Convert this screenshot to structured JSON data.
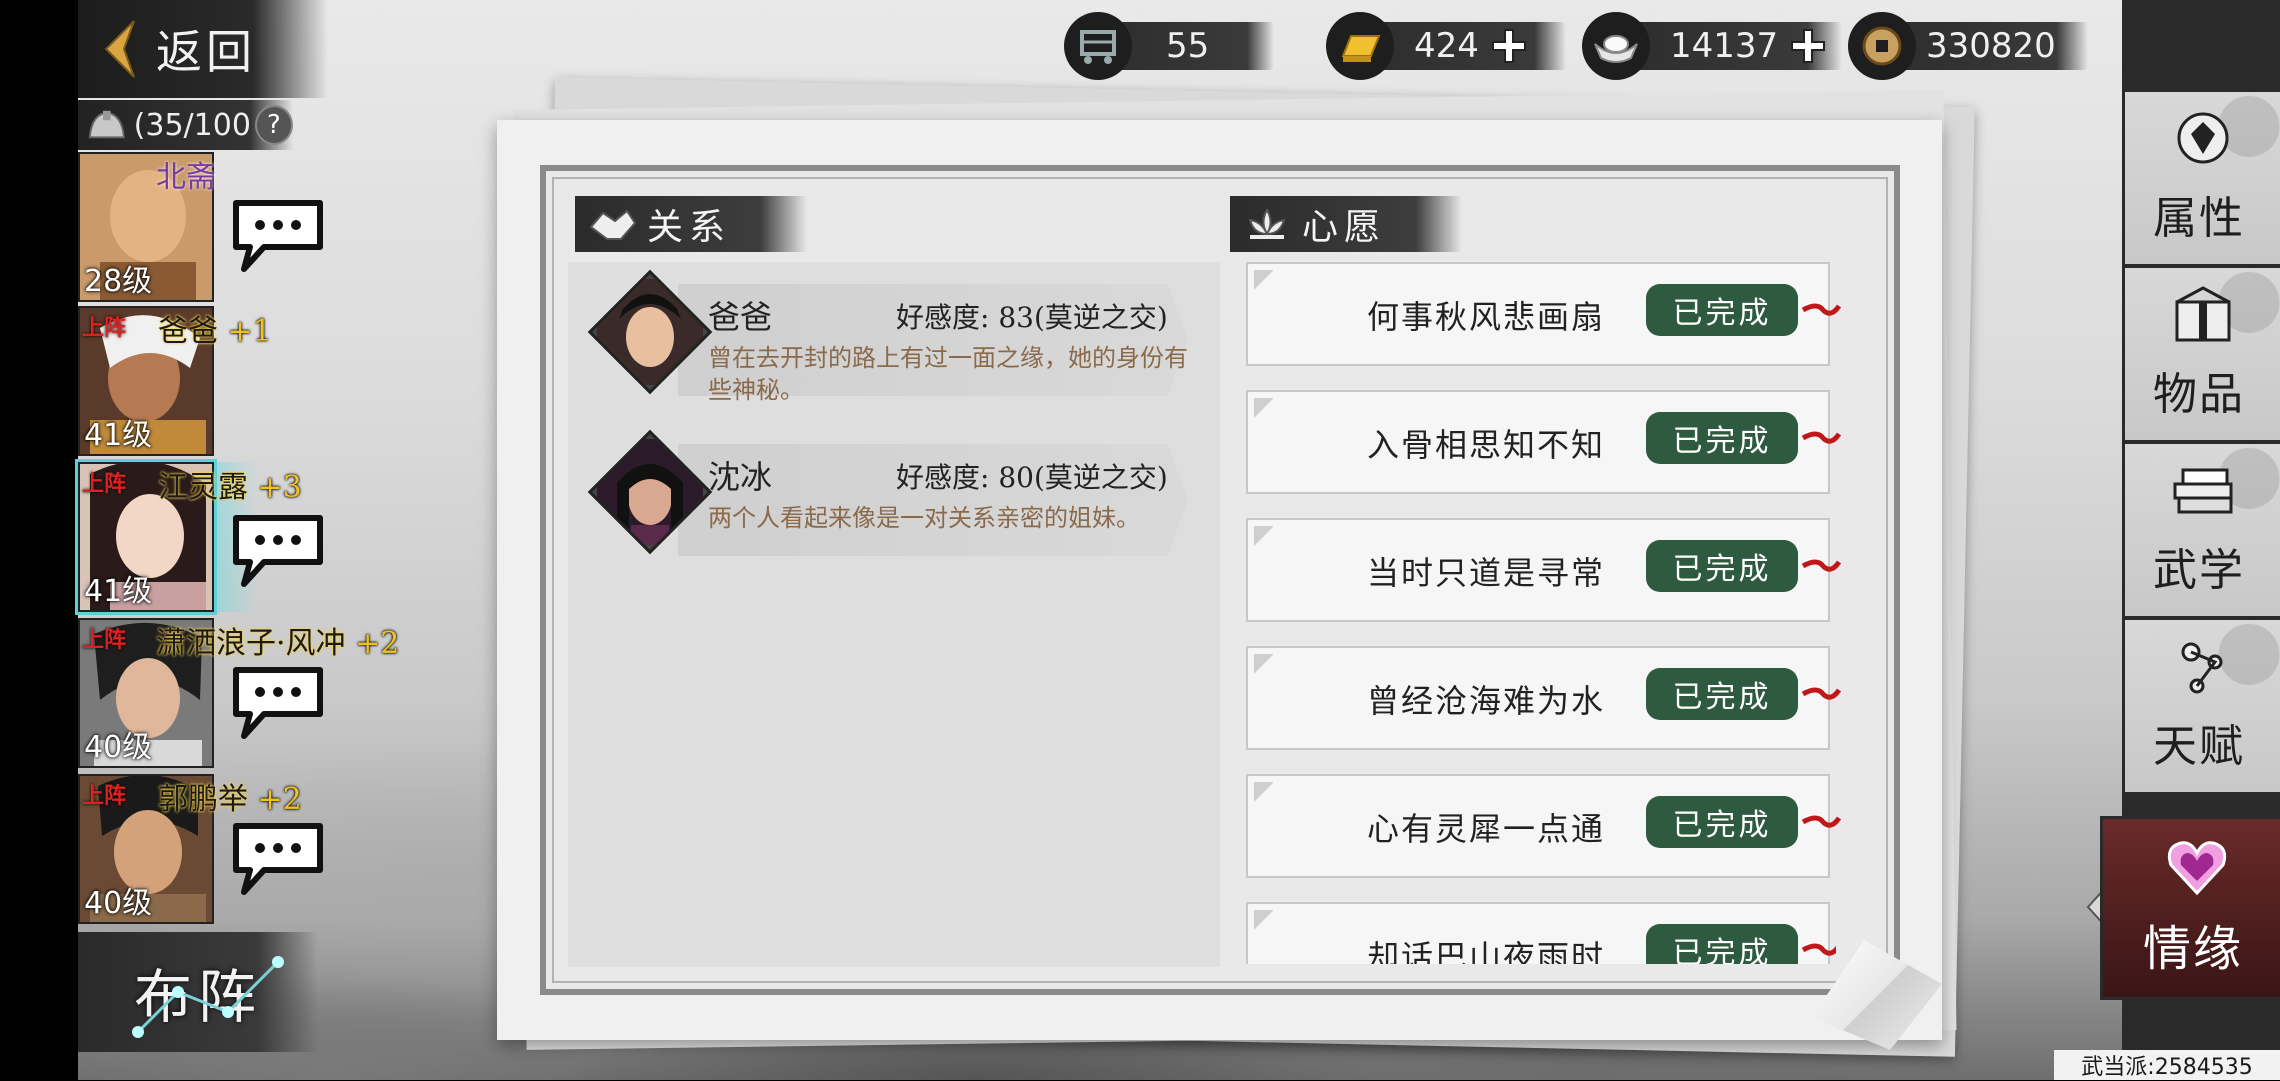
{
  "nav": {
    "back_label": "返回",
    "formation_label": "布阵"
  },
  "team": {
    "count": "(35/100",
    "help": "?"
  },
  "party": [
    {
      "name": "北斋",
      "bonus": "",
      "level": "28级",
      "tag": ""
    },
    {
      "name": "爸爸",
      "bonus": "+1",
      "level": "41级",
      "tag": "上阵"
    },
    {
      "name": "江灵露",
      "bonus": "+3",
      "level": "41级",
      "tag": "上阵"
    },
    {
      "name": "潇洒浪子·风冲",
      "bonus": "+2",
      "level": "40级",
      "tag": "上阵"
    },
    {
      "name": "郭鹏举",
      "bonus": "+2",
      "level": "40级",
      "tag": "上阵"
    }
  ],
  "currency": [
    {
      "icon": "inventory-cart-icon",
      "value": "55"
    },
    {
      "icon": "gold-bar-icon",
      "value": "424"
    },
    {
      "icon": "silver-ingot-icon",
      "value": "14137"
    },
    {
      "icon": "copper-coin-icon",
      "value": "330820"
    }
  ],
  "relations": {
    "title": "关系",
    "items": [
      {
        "name": "爸爸",
        "affinity_label": "好感度:",
        "affinity": "83(莫逆之交)",
        "desc": "曾在去开封的路上有过一面之缘，她的身份有些神秘。"
      },
      {
        "name": "沈冰",
        "affinity_label": "好感度:",
        "affinity": "80(莫逆之交)",
        "desc": "两个人看起来像是一对关系亲密的姐妹。"
      }
    ]
  },
  "wishes": {
    "title": "心愿",
    "items": [
      {
        "text": "何事秋风悲画扇",
        "status": "已完成"
      },
      {
        "text": "入骨相思知不知",
        "status": "已完成"
      },
      {
        "text": "当时只道是寻常",
        "status": "已完成"
      },
      {
        "text": "曾经沧海难为水",
        "status": "已完成"
      },
      {
        "text": "心有灵犀一点通",
        "status": "已完成"
      },
      {
        "text": "却话巴山夜雨时",
        "status": "已完成"
      }
    ]
  },
  "tabs": [
    {
      "label": "属性",
      "icon": "attributes-icon"
    },
    {
      "label": "物品",
      "icon": "items-icon"
    },
    {
      "label": "武学",
      "icon": "martial-arts-icon"
    },
    {
      "label": "天赋",
      "icon": "talent-icon"
    },
    {
      "label": "情缘",
      "icon": "romance-icon",
      "active": true
    }
  ],
  "guild": "武当派:2584535",
  "colors": {
    "status_green": "#2e5a40",
    "active_tab": "#5a2222",
    "name_gold": "#f2c21a",
    "tag_red": "#e02020"
  }
}
